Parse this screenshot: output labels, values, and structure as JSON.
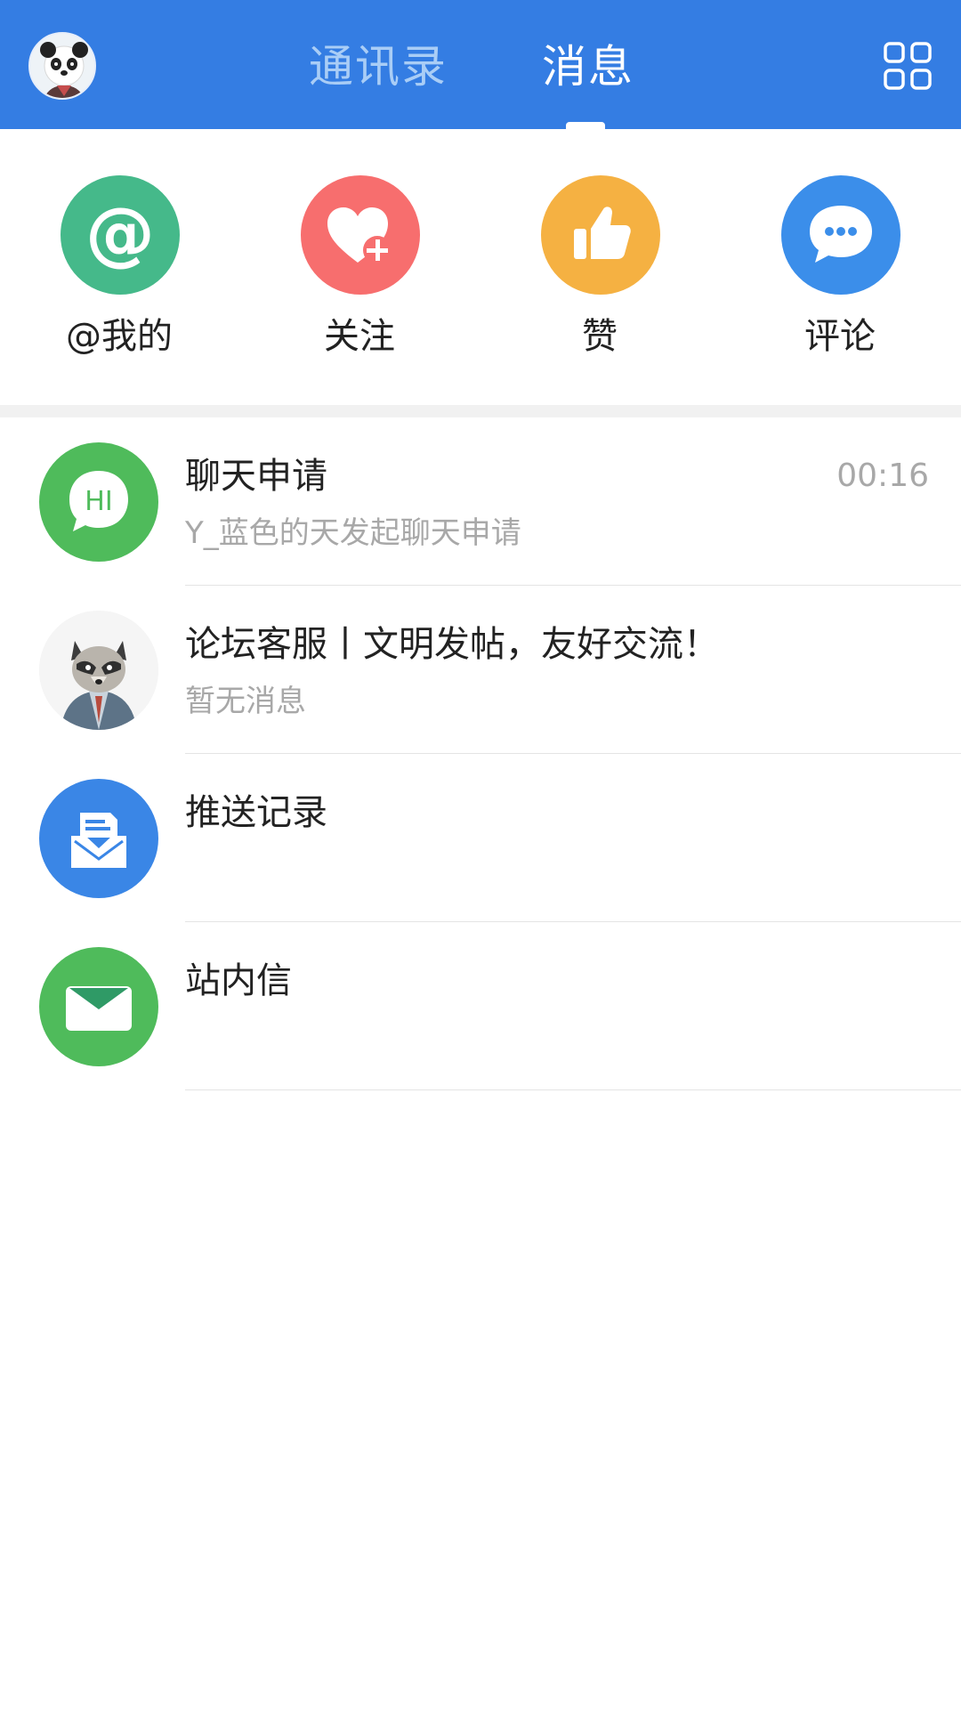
{
  "header": {
    "avatar_icon": "panda-avatar-icon",
    "tabs": [
      {
        "label": "通讯录",
        "active": false
      },
      {
        "label": "消息",
        "active": true
      }
    ],
    "menu_icon": "grid-icon"
  },
  "quick_actions": [
    {
      "label": "@我的",
      "icon": "at-icon",
      "color": "#45b98a"
    },
    {
      "label": "关注",
      "icon": "heart-plus-icon",
      "color": "#f76e6e"
    },
    {
      "label": "赞",
      "icon": "thumbs-up-icon",
      "color": "#f5b142"
    },
    {
      "label": "评论",
      "icon": "chat-bubble-icon",
      "color": "#3b8eea"
    }
  ],
  "messages": [
    {
      "title": "聊天申请",
      "subtitle": "Y_蓝色的天发起聊天申请",
      "time": "00:16",
      "icon": "hi-bubble-icon",
      "color": "#4fbb5b",
      "icon_text": "HI"
    },
    {
      "title": "论坛客服丨文明发帖，友好交流！",
      "subtitle": "暂无消息",
      "time": "",
      "icon": "raccoon-avatar-icon"
    },
    {
      "title": "推送记录",
      "subtitle": "",
      "time": "",
      "icon": "envelope-open-icon",
      "color": "#3a86e6"
    },
    {
      "title": "站内信",
      "subtitle": "",
      "time": "",
      "icon": "mail-icon",
      "color": "#4fbb5b"
    }
  ],
  "colors": {
    "header_bg": "#347de3",
    "tab_inactive": "#a9cdf6",
    "tab_active": "#ffffff"
  }
}
